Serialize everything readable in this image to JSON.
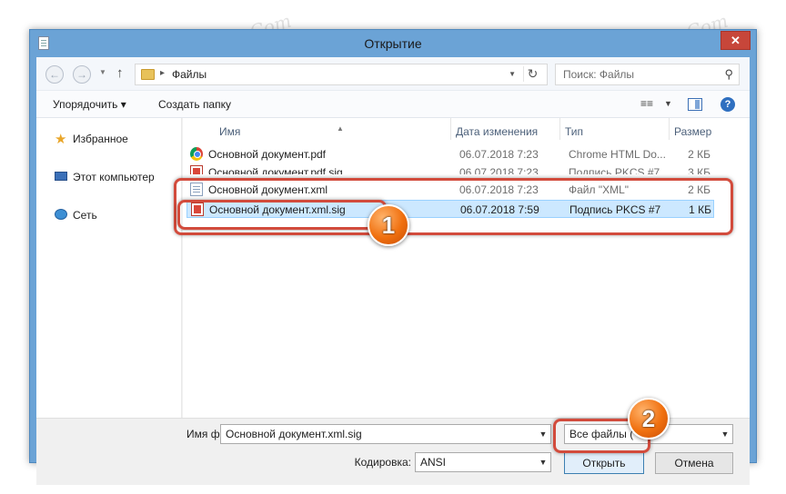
{
  "window": {
    "title": "Открытие",
    "close_label": "✕"
  },
  "nav": {
    "back_icon": "back-arrow-icon",
    "forward_icon": "forward-arrow-icon",
    "address": {
      "path": "Файлы"
    },
    "search_placeholder": "Поиск: Файлы"
  },
  "toolbar": {
    "organize_label": "Упорядочить ▾",
    "new_folder_label": "Создать папку",
    "help_label": "?"
  },
  "sidebar": {
    "items": [
      {
        "label": "Избранное",
        "icon": "star-icon"
      },
      {
        "label": "Этот компьютер",
        "icon": "computer-icon"
      },
      {
        "label": "Сеть",
        "icon": "network-icon"
      }
    ]
  },
  "columns": {
    "name": "Имя",
    "date": "Дата изменения",
    "type": "Тип",
    "size": "Размер"
  },
  "files": [
    {
      "name": "Основной документ.pdf",
      "date": "06.07.2018 7:23",
      "type": "Chrome HTML Do...",
      "size": "2 КБ",
      "icon": "chrome-file-icon"
    },
    {
      "name": "Основной документ.pdf.sig",
      "date": "06.07.2018 7:23",
      "type": "Подпись PKCS #7",
      "size": "3 КБ",
      "icon": "signature-file-icon"
    },
    {
      "name": "Основной документ.xml",
      "date": "06.07.2018 7:23",
      "type": "Файл \"XML\"",
      "size": "2 КБ",
      "icon": "xml-file-icon"
    },
    {
      "name": "Основной документ.xml.sig",
      "date": "06.07.2018 7:59",
      "type": "Подпись PKCS #7",
      "size": "1 КБ",
      "icon": "signature-file-icon"
    }
  ],
  "footer": {
    "filename_label": "Имя файла:",
    "filename_value": "Основной документ.xml.sig",
    "filter_value": "Все файлы (",
    "encoding_label": "Кодировка:",
    "encoding_value": "ANSI",
    "open_label": "Открыть",
    "cancel_label": "Отмена"
  },
  "annotations": {
    "badge1": "1",
    "badge2": "2",
    "highlight_color": "#d24b3c",
    "badge_color": "#f0700f"
  },
  "watermark": "Soringpcrepair.Com"
}
